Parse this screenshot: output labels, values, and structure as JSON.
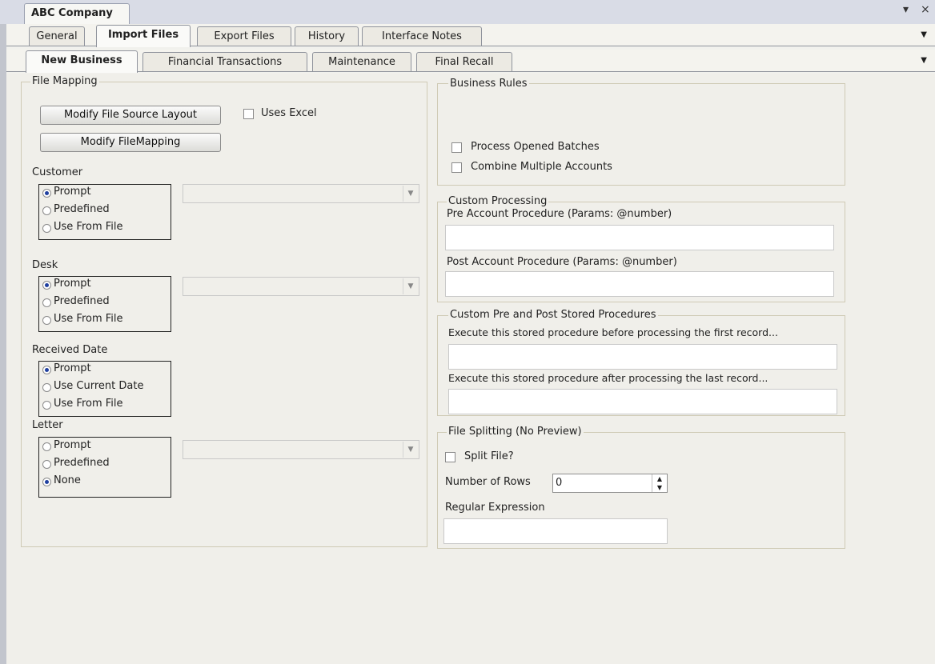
{
  "document_tab": {
    "title": "ABC Company"
  },
  "window_controls": {
    "pin": "▾",
    "close": "×"
  },
  "main_tabs": [
    "General",
    "Import Files",
    "Export Files",
    "History",
    "Interface Notes"
  ],
  "main_tabs_active": "Import Files",
  "sub_tabs": [
    "New Business",
    "Financial Transactions",
    "Maintenance",
    "Final Recall"
  ],
  "sub_tabs_active": "New Business",
  "file_mapping": {
    "title": "File Mapping",
    "modify_source_layout": "Modify File Source Layout",
    "modify_file_mapping": "Modify FileMapping",
    "uses_excel": "Uses Excel",
    "customer": {
      "label": "Customer",
      "options": [
        "Prompt",
        "Predefined",
        "Use From File"
      ],
      "selected": "Prompt"
    },
    "desk": {
      "label": "Desk",
      "options": [
        "Prompt",
        "Predefined",
        "Use From File"
      ],
      "selected": "Prompt"
    },
    "received_date": {
      "label": "Received Date",
      "options": [
        "Prompt",
        "Use Current Date",
        "Use From File"
      ],
      "selected": "Prompt"
    },
    "letter": {
      "label": "Letter",
      "options": [
        "Prompt",
        "Predefined",
        "None"
      ],
      "selected": "None"
    }
  },
  "business_rules": {
    "title": "Business Rules",
    "process_opened_batches": "Process Opened Batches",
    "combine_multiple_accounts": "Combine Multiple Accounts"
  },
  "custom_processing": {
    "title": "Custom Processing",
    "pre_label": "Pre Account Procedure (Params: @number)",
    "post_label": "Post Account Procedure (Params: @number)"
  },
  "custom_pre_post": {
    "title": "Custom Pre and Post Stored Procedures",
    "before_label": "Execute this stored procedure before processing the first record...",
    "after_label": "Execute this stored procedure after processing the last record..."
  },
  "file_splitting": {
    "title": "File Splitting (No Preview)",
    "split_file": "Split File?",
    "rows_label": "Number of Rows",
    "rows_value": "0",
    "regex_label": "Regular Expression"
  }
}
